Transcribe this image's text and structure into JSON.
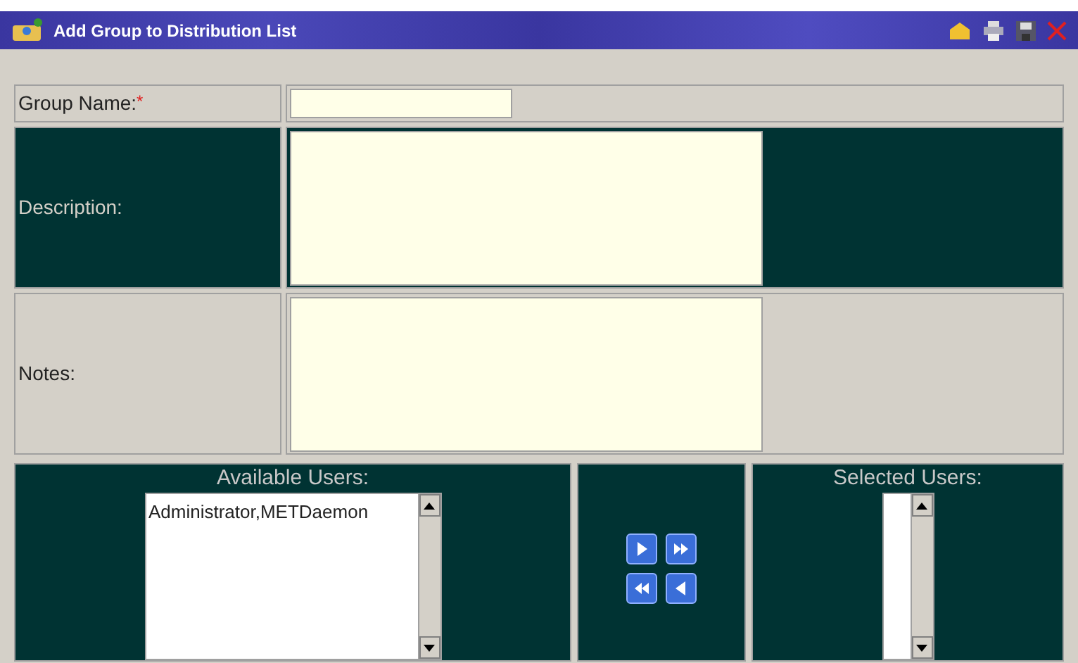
{
  "window": {
    "title": "Add Group to Distribution List"
  },
  "form": [
    {
      "kind": "text",
      "label": "Group Name:",
      "required_mark": "*"
    },
    {
      "kind": "textarea",
      "label": "Description:"
    },
    {
      "kind": "textarea",
      "label": "Notes:"
    }
  ],
  "available_users": {
    "label": "Available Users:",
    "items": [
      "Administrator,METDaemon"
    ]
  },
  "selected_users": {
    "label": "Selected Users:"
  }
}
